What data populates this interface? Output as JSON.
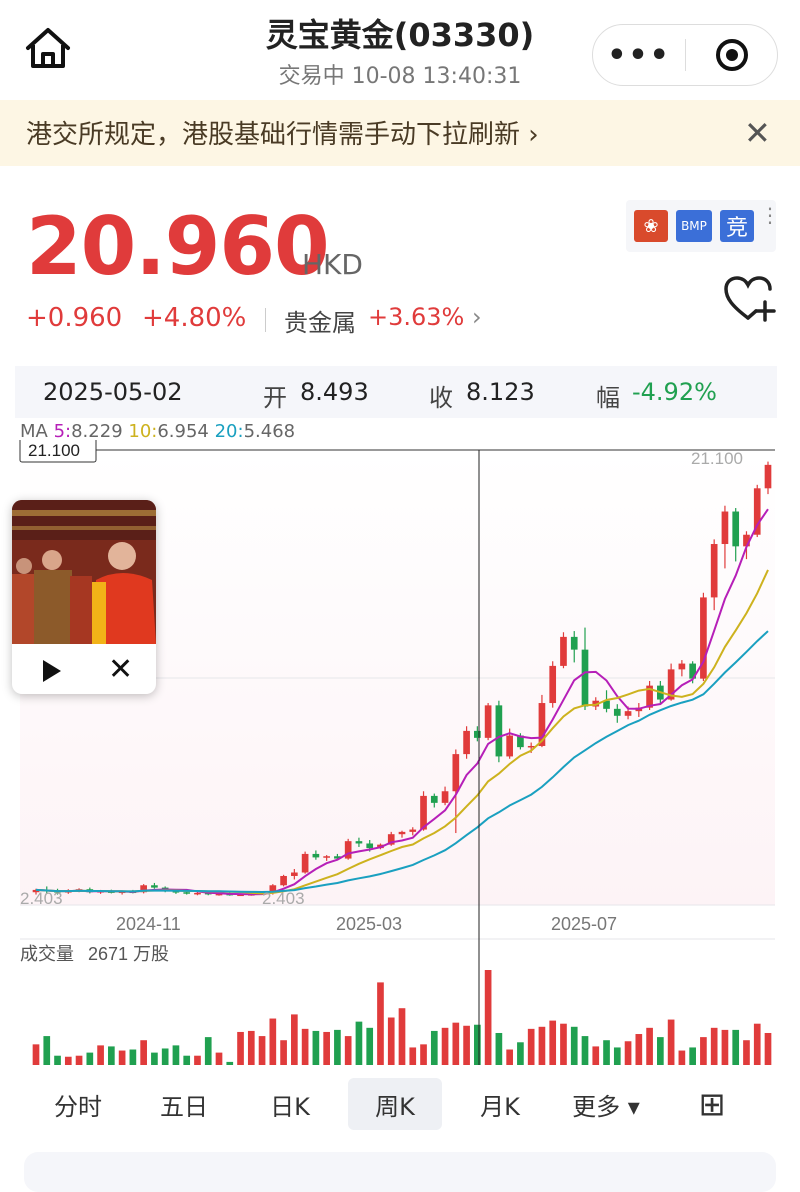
{
  "header": {
    "title": "灵宝黄金(03330)",
    "status": "交易中 10-08 13:40:31",
    "home_icon": "home-icon",
    "more_icon": "more-dots-icon",
    "target_icon": "target-icon"
  },
  "banner": {
    "text": "港交所规定，港股基础行情需手动下拉刷新 ›",
    "close": "✕"
  },
  "quote": {
    "price": "20.960",
    "currency": "HKD",
    "change": "+0.960",
    "change_pct": "+4.80%",
    "sector": "贵金属",
    "sector_change": "+3.63%",
    "sector_arrow": "›",
    "badges": {
      "hk": "❀",
      "bmp": "BMP",
      "jing": "竞"
    },
    "color_up": "#e03b3b",
    "color_down": "#20a050"
  },
  "ohlc_bar": {
    "date": "2025-05-02",
    "open_label": "开",
    "open_value": "8.493",
    "close_label": "收",
    "close_value": "8.123",
    "amp_label": "幅",
    "amp_value": "-4.92%"
  },
  "ma": {
    "ma_label": "MA",
    "ma5_label": "5:",
    "ma5_value": "8.229",
    "ma10_label": "10:",
    "ma10_value": "6.954",
    "ma20_label": "20:",
    "ma20_value": "5.468",
    "colors": {
      "ma5": "#b61fb8",
      "ma10": "#cdb21e",
      "ma20": "#1aa0c0"
    }
  },
  "chart_data": {
    "type": "candlestick",
    "price_high_label": "21.100",
    "price_high_tag": "21.100",
    "price_low_label": "2.403",
    "price_low_tag": "2.403",
    "x_ticks": [
      "2024-11",
      "2025-03",
      "2025-07"
    ],
    "volume_label": "成交量",
    "volume_value": "2671 万股",
    "ylim": [
      2.0,
      21.6
    ],
    "candles": [
      [
        2.55,
        2.7,
        2.45,
        2.65
      ],
      [
        2.65,
        2.8,
        2.5,
        2.6
      ],
      [
        2.6,
        2.7,
        2.45,
        2.55
      ],
      [
        2.55,
        2.68,
        2.48,
        2.6
      ],
      [
        2.6,
        2.72,
        2.55,
        2.68
      ],
      [
        2.68,
        2.75,
        2.5,
        2.55
      ],
      [
        2.55,
        2.65,
        2.48,
        2.6
      ],
      [
        2.6,
        2.66,
        2.5,
        2.52
      ],
      [
        2.52,
        2.62,
        2.45,
        2.58
      ],
      [
        2.58,
        2.65,
        2.5,
        2.55
      ],
      [
        2.55,
        2.9,
        2.5,
        2.85
      ],
      [
        2.85,
        2.95,
        2.7,
        2.75
      ],
      [
        2.75,
        2.8,
        2.55,
        2.6
      ],
      [
        2.6,
        2.65,
        2.48,
        2.55
      ],
      [
        2.55,
        2.62,
        2.45,
        2.5
      ],
      [
        2.5,
        2.58,
        2.42,
        2.52
      ],
      [
        2.52,
        2.6,
        2.42,
        2.46
      ],
      [
        2.46,
        2.52,
        2.4,
        2.48
      ],
      [
        2.48,
        2.55,
        2.4,
        2.44
      ],
      [
        2.44,
        2.5,
        2.4,
        2.45
      ],
      [
        2.45,
        2.52,
        2.4,
        2.47
      ],
      [
        2.47,
        2.55,
        2.43,
        2.5
      ],
      [
        2.5,
        2.9,
        2.45,
        2.85
      ],
      [
        2.85,
        3.3,
        2.8,
        3.25
      ],
      [
        3.25,
        3.55,
        3.1,
        3.4
      ],
      [
        3.4,
        4.3,
        3.35,
        4.2
      ],
      [
        4.2,
        4.35,
        3.95,
        4.05
      ],
      [
        4.05,
        4.15,
        3.9,
        4.1
      ],
      [
        4.1,
        4.2,
        3.95,
        4.0
      ],
      [
        4.0,
        4.85,
        3.95,
        4.75
      ],
      [
        4.75,
        4.9,
        4.5,
        4.65
      ],
      [
        4.65,
        4.8,
        4.3,
        4.45
      ],
      [
        4.45,
        4.65,
        4.4,
        4.6
      ],
      [
        4.6,
        5.15,
        4.55,
        5.05
      ],
      [
        5.05,
        5.2,
        4.9,
        5.15
      ],
      [
        5.15,
        5.35,
        5.0,
        5.25
      ],
      [
        5.25,
        6.9,
        5.2,
        6.7
      ],
      [
        6.7,
        6.8,
        6.2,
        6.4
      ],
      [
        6.4,
        7.1,
        6.3,
        6.9
      ],
      [
        6.9,
        8.7,
        5.1,
        8.5
      ],
      [
        8.5,
        9.7,
        8.3,
        9.5
      ],
      [
        9.5,
        9.7,
        9.05,
        9.2
      ],
      [
        9.2,
        10.7,
        9.1,
        10.6
      ],
      [
        10.6,
        10.8,
        8.15,
        8.4
      ],
      [
        8.4,
        9.6,
        8.3,
        9.3
      ],
      [
        9.3,
        9.4,
        8.7,
        8.8
      ],
      [
        8.8,
        9.0,
        8.55,
        8.85
      ],
      [
        8.85,
        11.05,
        8.8,
        10.7
      ],
      [
        10.7,
        12.5,
        10.5,
        12.3
      ],
      [
        12.3,
        13.75,
        12.2,
        13.55
      ],
      [
        13.55,
        13.8,
        12.45,
        13.0
      ],
      [
        13.0,
        13.95,
        10.4,
        10.55
      ],
      [
        10.55,
        10.95,
        10.4,
        10.8
      ],
      [
        10.8,
        11.25,
        10.3,
        10.45
      ],
      [
        10.45,
        10.65,
        9.85,
        10.15
      ],
      [
        10.15,
        10.55,
        10.0,
        10.35
      ],
      [
        10.35,
        10.7,
        10.1,
        10.5
      ],
      [
        10.5,
        11.65,
        10.4,
        11.45
      ],
      [
        11.45,
        11.65,
        10.7,
        10.85
      ],
      [
        10.85,
        12.4,
        10.8,
        12.15
      ],
      [
        12.15,
        12.55,
        11.85,
        12.4
      ],
      [
        12.4,
        12.5,
        11.55,
        11.75
      ],
      [
        11.75,
        15.45,
        11.65,
        15.25
      ],
      [
        15.25,
        17.75,
        14.7,
        17.55
      ],
      [
        17.55,
        19.2,
        16.5,
        18.95
      ],
      [
        18.95,
        19.1,
        16.8,
        17.45
      ],
      [
        17.45,
        18.1,
        16.9,
        17.95
      ],
      [
        17.95,
        20.1,
        17.85,
        19.95
      ],
      [
        19.95,
        21.1,
        19.7,
        20.96
      ]
    ],
    "volumes": [
      20,
      28,
      9,
      8,
      9,
      12,
      19,
      18,
      14,
      15,
      24,
      12,
      16,
      19,
      9,
      9,
      27,
      12,
      3,
      32,
      33,
      28,
      45,
      24,
      49,
      35,
      33,
      32,
      34,
      28,
      42,
      36,
      80,
      46,
      55,
      17,
      20,
      33,
      36,
      41,
      38,
      39,
      92,
      31,
      15,
      22,
      35,
      37,
      43,
      40,
      37,
      28,
      18,
      24,
      17,
      23,
      30,
      36,
      27,
      44,
      14,
      17,
      27,
      36,
      34,
      34,
      24,
      40,
      31
    ]
  },
  "popup": {
    "image_alt": "video-thumbnail",
    "play_icon": "play-icon",
    "close": "✕"
  },
  "tabs": [
    {
      "label": "分时",
      "active": false
    },
    {
      "label": "五日",
      "active": false
    },
    {
      "label": "日K",
      "active": false
    },
    {
      "label": "周K",
      "active": true
    },
    {
      "label": "月K",
      "active": false
    },
    {
      "label": "更多 ▾",
      "active": false
    },
    {
      "label": "⊞",
      "active": false
    }
  ]
}
